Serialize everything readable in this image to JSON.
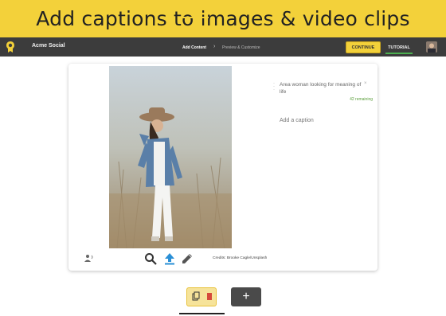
{
  "banner": {
    "title": "Add captions to images & video clips"
  },
  "topbar": {
    "app_name": "Acme Social",
    "steps": [
      {
        "label": "Add Content",
        "active": true
      },
      {
        "label": "Preview & Customize",
        "active": false
      }
    ],
    "continue_label": "CONTINUE",
    "tutorial_label": "TUTORIAL"
  },
  "editor": {
    "caption_text": "Area woman looking for meaning of life",
    "remaining": "42 remaining",
    "add_caption_placeholder": "Add a caption",
    "credits": "Credits: Brooke Cagle/Unsplash"
  },
  "icons": {
    "logo": "logo-icon",
    "voice": "voice-icon",
    "search": "search-icon",
    "upload": "upload-icon",
    "edit": "pencil-icon",
    "add": "plus-icon",
    "remove": "close-icon",
    "reorder": "drag-handle-icon"
  },
  "colors": {
    "banner": "#f3d13a",
    "topbar": "#3c3c3c",
    "accent_blue": "#2a8fd6",
    "remaining_green": "#5a9e3a",
    "tutorial_underline": "#4caf50"
  },
  "footer": {
    "add_label": "+"
  }
}
